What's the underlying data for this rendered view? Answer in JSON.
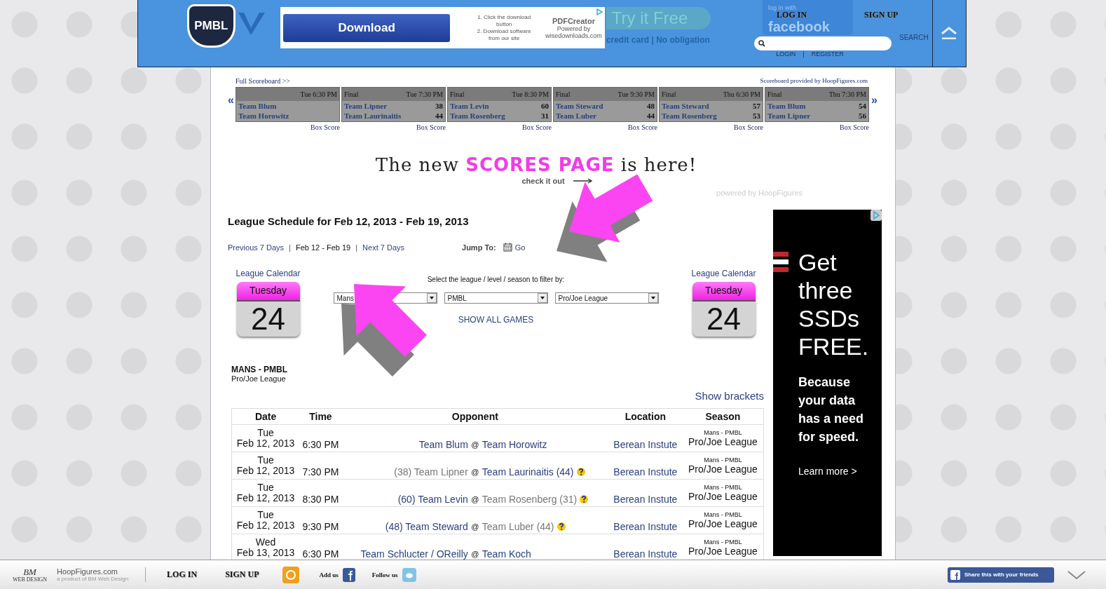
{
  "header": {
    "logo": "PMBL",
    "ad": {
      "button": "Download",
      "steps": [
        "1. Click the download button",
        "2. Download software from our site"
      ],
      "brand": "PDFCreator",
      "powered": "Powered by",
      "site": "wisedownloads.com"
    },
    "background_ad": {
      "headline": "Try it Free",
      "subline": "credit card | No obligation"
    },
    "facebook": {
      "caption": "log in with",
      "label": "facebook"
    },
    "login": "LOG IN",
    "signup": "SIGN UP",
    "account_links": {
      "login": "LOGIN",
      "separator": "|",
      "register": "REGISTER"
    },
    "search_label": "SEARCH"
  },
  "scoreboard": {
    "full_link": "Full Scoreboard >>",
    "provider": "Scoreboard provided by HoopFigures.com",
    "prev": "«",
    "next": "»",
    "games": [
      {
        "time": "Tue 6:30 PM",
        "teams": [
          {
            "name": "Team Blum"
          },
          {
            "name": "Team Horowitz"
          }
        ],
        "box_score": "Box Score"
      },
      {
        "status": "Final",
        "time": "Tue 7:30 PM",
        "teams": [
          {
            "name": "Team Lipner",
            "score": "38"
          },
          {
            "name": "Team Laurinaitis",
            "score": "44"
          }
        ],
        "box_score": "Box Score"
      },
      {
        "status": "Final",
        "time": "Tue 8:30 PM",
        "teams": [
          {
            "name": "Team Levin",
            "score": "60"
          },
          {
            "name": "Team Rosenberg",
            "score": "31"
          }
        ],
        "box_score": "Box Score"
      },
      {
        "status": "Final",
        "time": "Tue 9:30 PM",
        "teams": [
          {
            "name": "Team Steward",
            "score": "48"
          },
          {
            "name": "Team Luber",
            "score": "44"
          }
        ],
        "box_score": "Box Score"
      },
      {
        "status": "Final",
        "time": "Thu 6:30 PM",
        "teams": [
          {
            "name": "Team Steward",
            "score": "57"
          },
          {
            "name": "Team Rosenberg",
            "score": "53"
          }
        ],
        "box_score": "Box Score"
      },
      {
        "status": "Final",
        "time": "Thu 7:30 PM",
        "teams": [
          {
            "name": "Team Blum",
            "score": "54"
          },
          {
            "name": "Team Lipner",
            "score": "56"
          }
        ],
        "box_score": "Box Score"
      }
    ]
  },
  "banner": {
    "lead": "The new",
    "highlight": "SCORES PAGE",
    "tail": "is here!",
    "cta": "check it out",
    "powered": "powered by HoopFigures"
  },
  "schedule": {
    "title": "League Schedule for Feb 12, 2013 - Feb 19, 2013",
    "nav": [
      {
        "label": "Previous 7 Days",
        "selected": false
      },
      {
        "label": "Feb 12 - Feb 19",
        "selected": true
      },
      {
        "label": "Next 7 Days",
        "selected": false
      }
    ],
    "nav_separator": "|",
    "jump_label": "Jump To:",
    "go": "Go",
    "calendars": [
      {
        "caption": "League Calendar",
        "weekday": "Tuesday",
        "day": "24"
      },
      {
        "caption": "League Calendar",
        "weekday": "Tuesday",
        "day": "24"
      }
    ],
    "filter_prompt": "Select the league / level / season to filter by:",
    "filters": [
      {
        "value": "Mans"
      },
      {
        "value": "PMBL"
      },
      {
        "value": "Pro/Joe League"
      }
    ],
    "show_all": "SHOW ALL GAMES",
    "league": "MANS - PMBL",
    "season": "Pro/Joe League",
    "brackets": "Show brackets",
    "table": {
      "columns": [
        "Date",
        "Time",
        "Opponent",
        "Location",
        "Season"
      ],
      "rows": [
        {
          "day": "Tue",
          "date": "Feb 12, 2013",
          "time": "6:30 PM",
          "away": {
            "text": "Team Blum"
          },
          "separator": "@",
          "home": {
            "text": "Team Horowitz"
          },
          "info": false,
          "location": "Berean Instute",
          "division": "Mans - PMBL",
          "season": "Pro/Joe League"
        },
        {
          "day": "Tue",
          "date": "Feb 12, 2013",
          "time": "7:30 PM",
          "away": {
            "text": "(38) Team Lipner",
            "won": false
          },
          "separator": "@",
          "home": {
            "text": "Team Laurinaitis (44)",
            "won": true
          },
          "info": true,
          "location": "Berean Instute",
          "division": "Mans - PMBL",
          "season": "Pro/Joe League"
        },
        {
          "day": "Tue",
          "date": "Feb 12, 2013",
          "time": "8:30 PM",
          "away": {
            "text": "(60) Team Levin",
            "won": true
          },
          "separator": "@",
          "home": {
            "text": "Team Rosenberg (31)",
            "won": false
          },
          "info": true,
          "location": "Berean Instute",
          "division": "Mans - PMBL",
          "season": "Pro/Joe League"
        },
        {
          "day": "Tue",
          "date": "Feb 12, 2013",
          "time": "9:30 PM",
          "away": {
            "text": "(48) Team Steward",
            "won": true
          },
          "separator": "@",
          "home": {
            "text": "Team Luber (44)",
            "won": false
          },
          "info": true,
          "location": "Berean Instute",
          "division": "Mans - PMBL",
          "season": "Pro/Joe League"
        },
        {
          "day": "Wed",
          "date": "Feb 13, 2013",
          "time": "6:30 PM",
          "away": {
            "text": "Team Schlucter / OReilly"
          },
          "separator": "@",
          "home": {
            "text": "Team Koch"
          },
          "info": false,
          "location": "Berean Instute",
          "division": "Mans - PMBL",
          "season": "Pro/Joe League"
        }
      ]
    }
  },
  "side_ad": {
    "headline": "Get three SSDs FREE.",
    "body": "Because your data has a need for speed.",
    "link": "Learn more >"
  },
  "footer": {
    "logo": "BM",
    "logo_caption": "WEB DESIGN",
    "brand": "HoopFigures.com",
    "tagline": "a product of BM Web Design",
    "login": "LOG IN",
    "signup": "SIGN UP",
    "add_us": "Add us",
    "follow_us": "Follow us",
    "share": "Share this with your friends"
  }
}
